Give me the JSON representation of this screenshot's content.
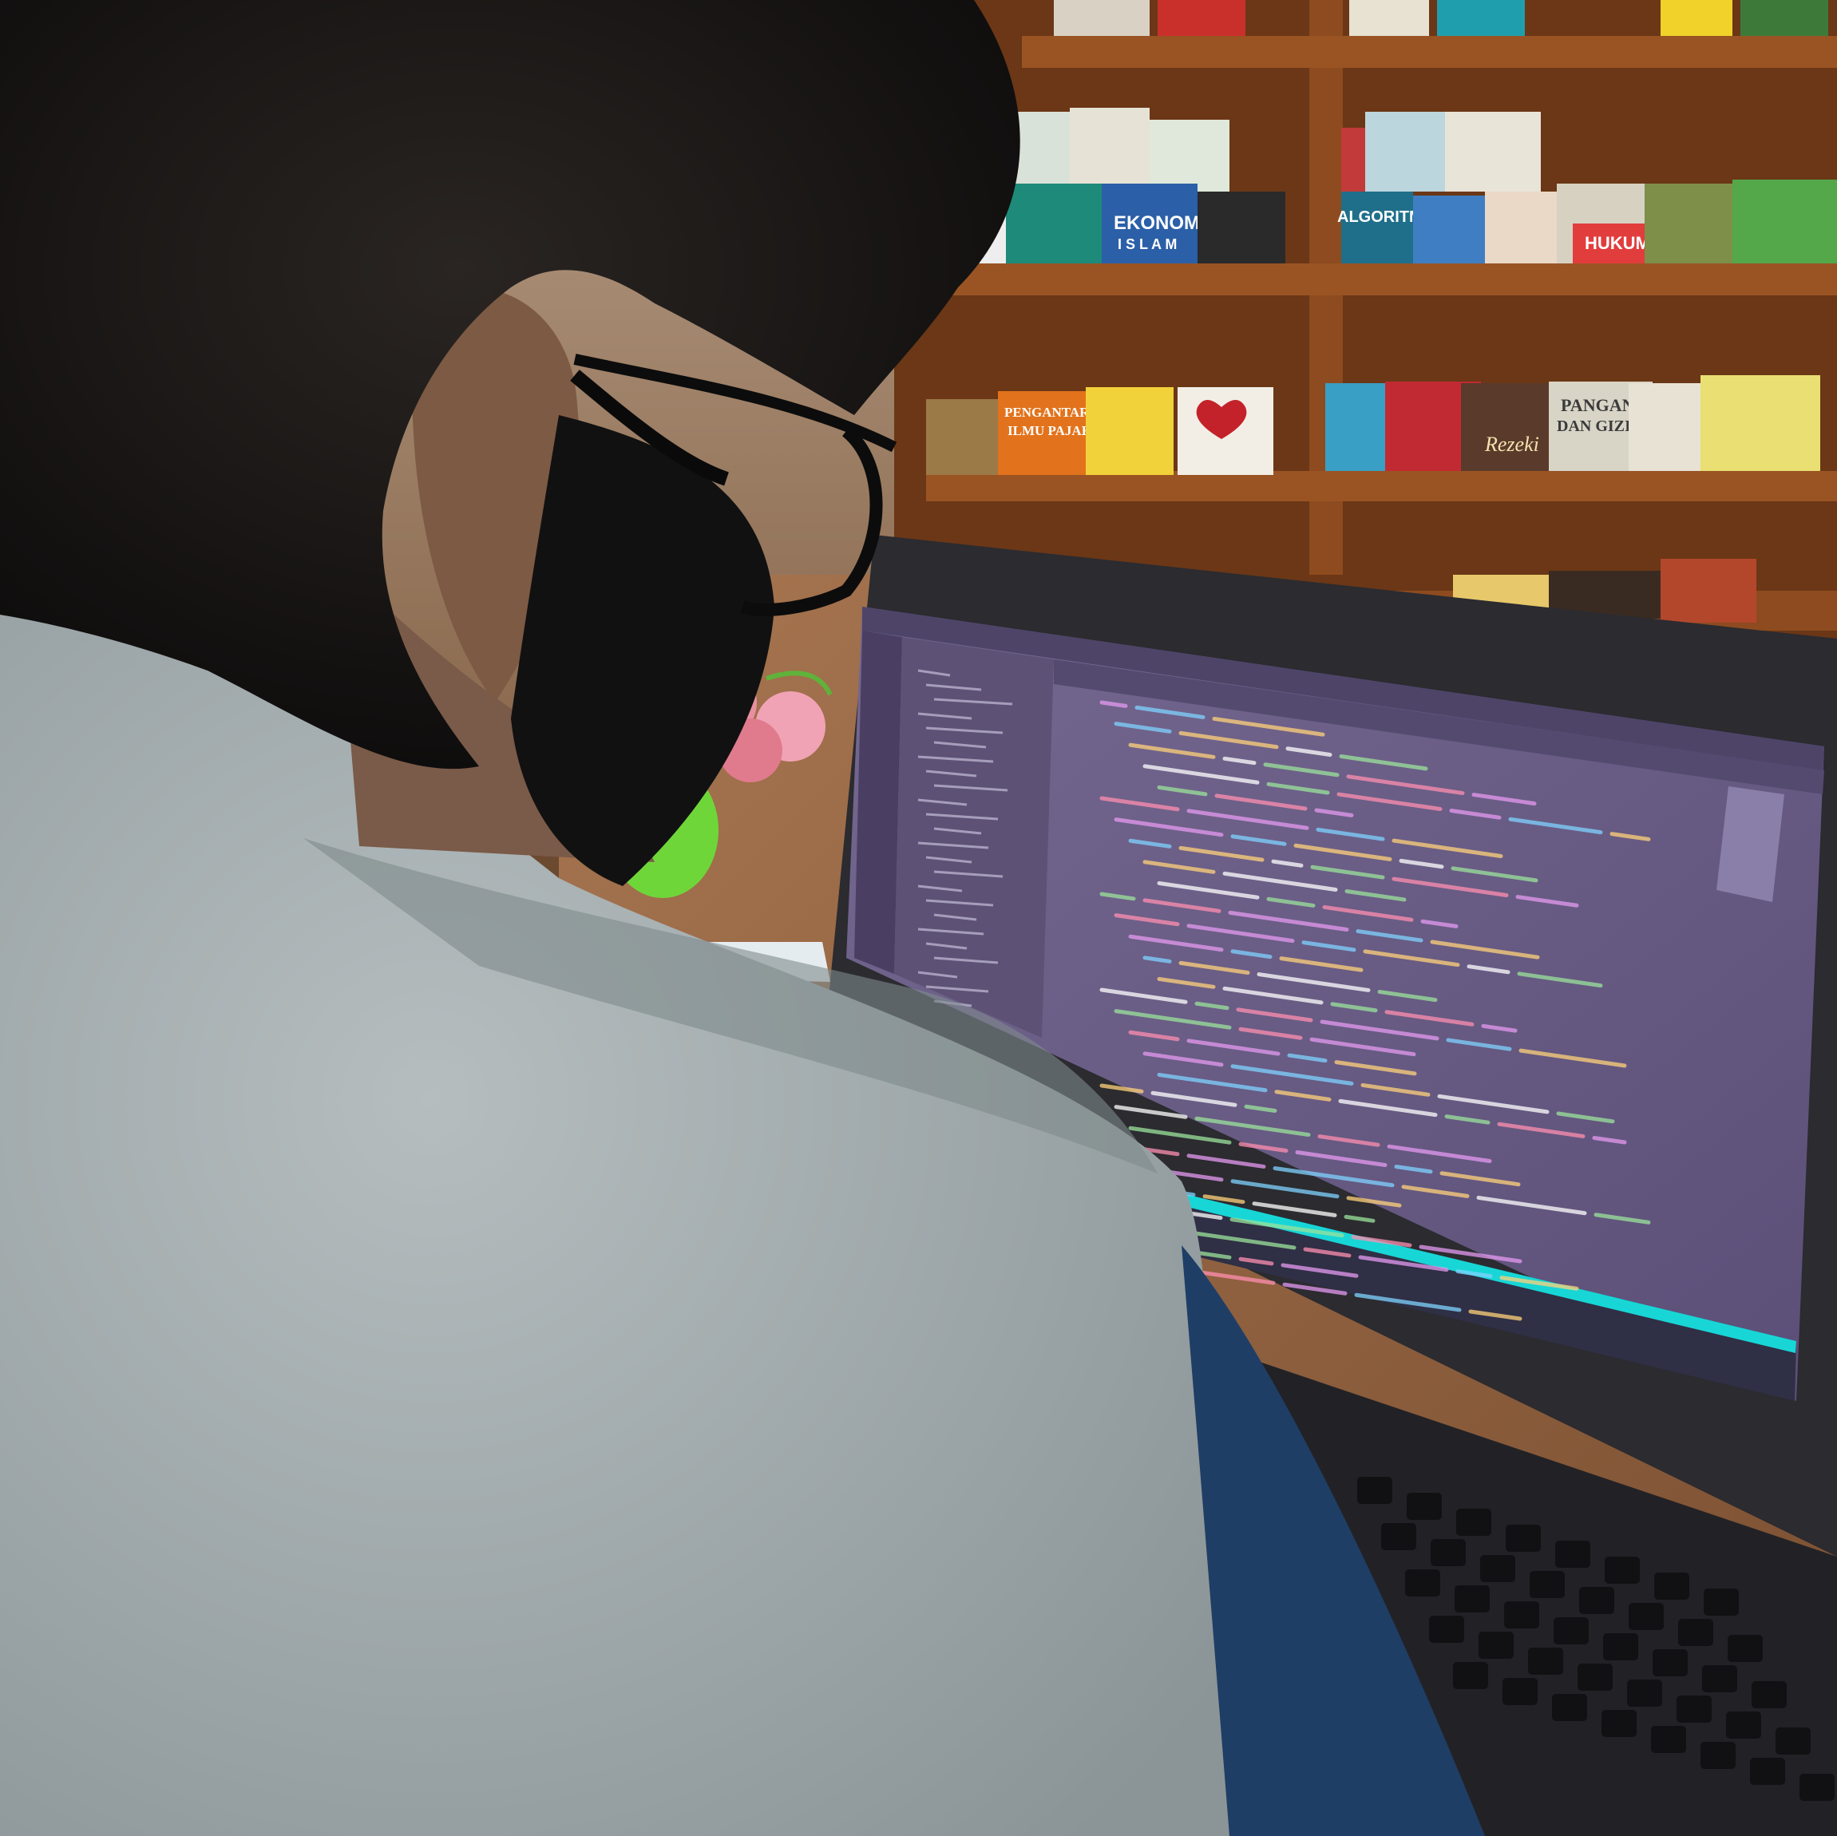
{
  "scene": {
    "kind": "photo",
    "colors": {
      "shelf_wood": "#8a4a1e",
      "shelf_dark": "#5a2e12",
      "wall": "#c9b8a6",
      "desk": "#9a6a45",
      "laptop_bezel": "#2a2a2e",
      "editor_bg": "#6c5f86",
      "editor_sidebar": "#5d5275",
      "taskbar_accent": "#18d6d6",
      "shirt": "#9fa9ab",
      "hair": "#141212",
      "sleeve": "#1f3e66"
    }
  },
  "books": {
    "spine_pengantar_line1": "PENGANTAR",
    "spine_pengantar_line2": "ILMU PAJAK",
    "spine_ekonomi": "EKONOMI",
    "spine_islam": "I S L A M",
    "spine_algoritma": "ALGORITMA",
    "spine_hukum": "HUKUM",
    "spine_pangan_line1": "PANGAN",
    "spine_pangan_line2": "DAN GIZI",
    "spine_rezeki": "Rezeki"
  },
  "laptop": {
    "screen": {
      "app": "code-editor",
      "theme": "dark-purple"
    }
  }
}
